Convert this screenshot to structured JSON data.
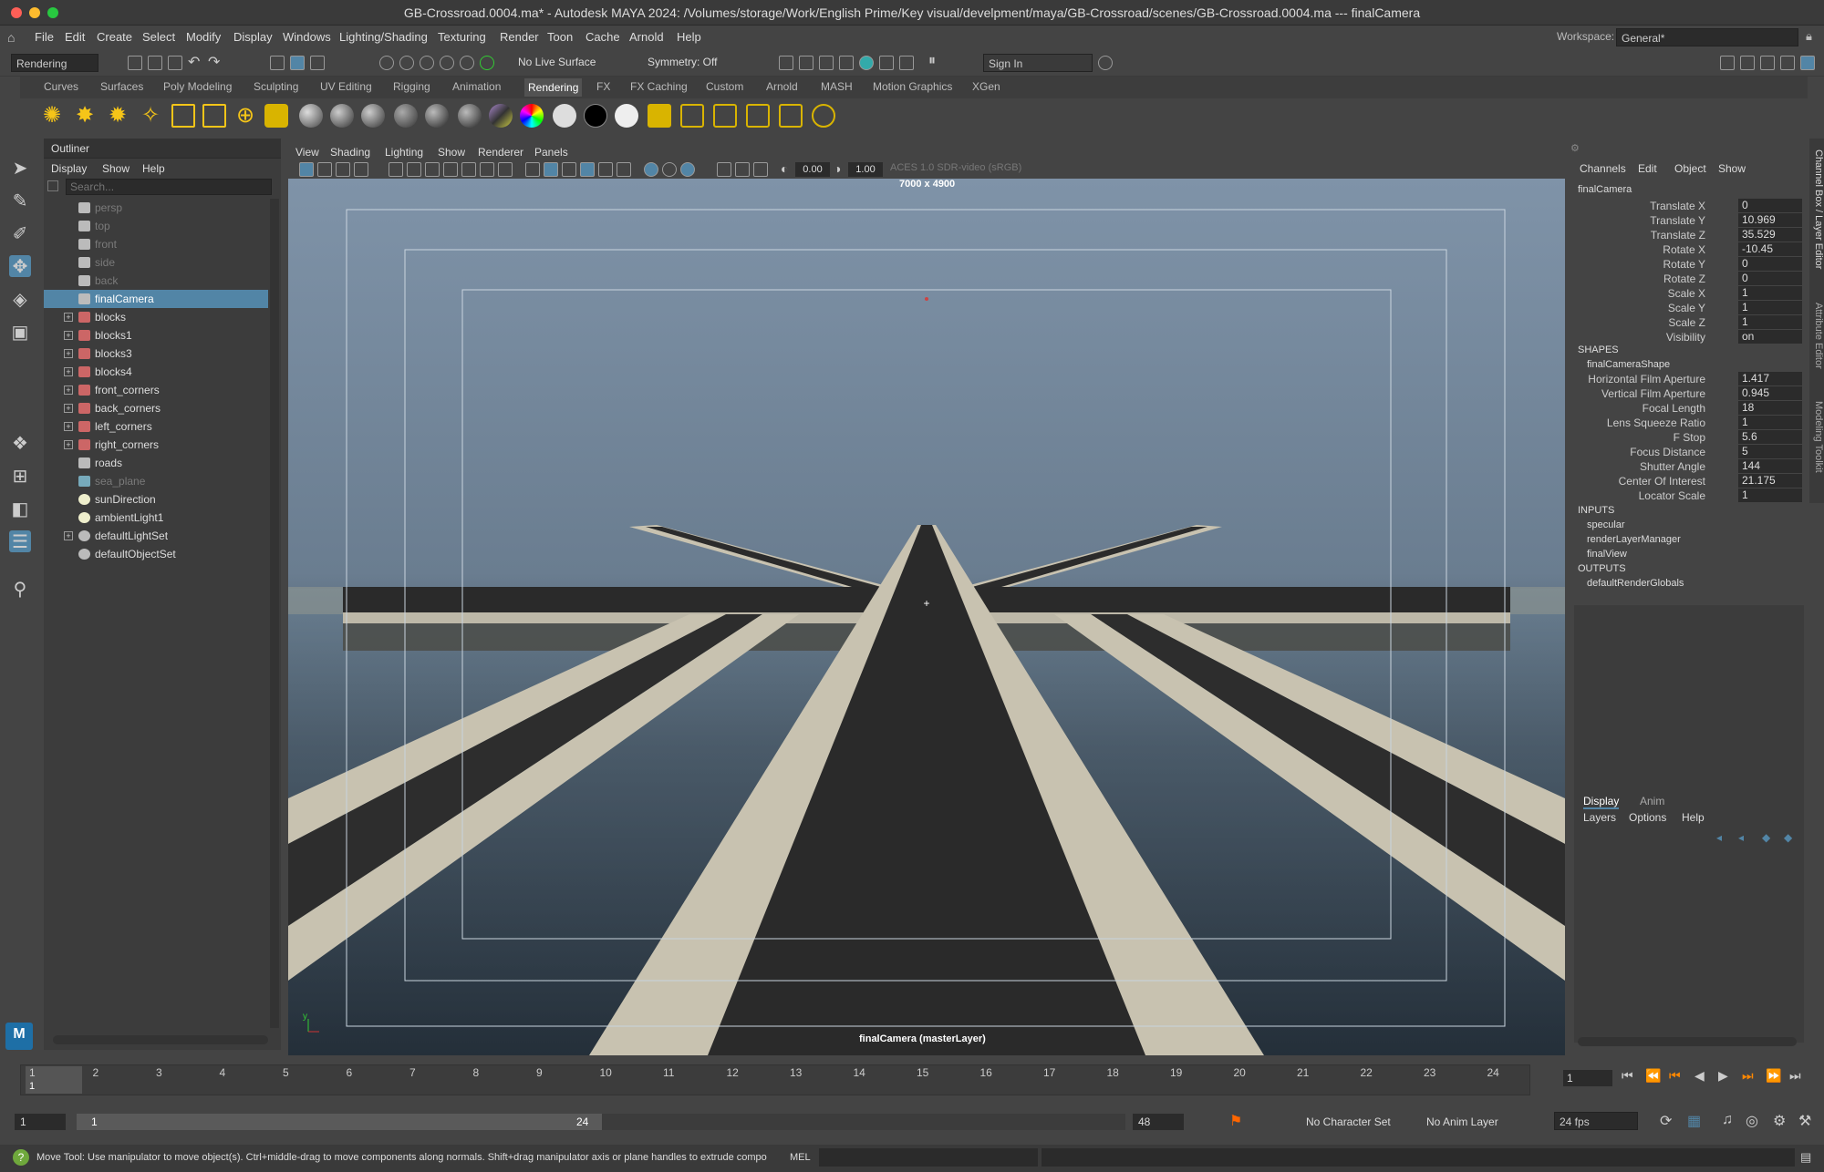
{
  "window": {
    "title": "GB-Crossroad.0004.ma* - Autodesk MAYA 2024: /Volumes/storage/Work/English Prime/Key visual/develpment/maya/GB-Crossroad/scenes/GB-Crossroad.0004.ma  ---  finalCamera"
  },
  "menubar": {
    "items": [
      "File",
      "Edit",
      "Create",
      "Select",
      "Modify",
      "Display",
      "Windows",
      "Lighting/Shading",
      "Texturing",
      "Render",
      "Toon",
      "Cache",
      "Arnold",
      "Help"
    ],
    "workspace_label": "Workspace:",
    "workspace_value": "General*"
  },
  "toolbar": {
    "mode_menu": "Rendering",
    "live_surface": "No Live Surface",
    "symmetry": "Symmetry: Off",
    "sign_in": "Sign In"
  },
  "shelf": {
    "tabs": [
      "Curves",
      "Surfaces",
      "Poly Modeling",
      "Sculpting",
      "UV Editing",
      "Rigging",
      "Animation",
      "Rendering",
      "FX",
      "FX Caching",
      "Custom",
      "Arnold",
      "MASH",
      "Motion Graphics",
      "XGen"
    ],
    "active_tab": "Rendering"
  },
  "outliner": {
    "title": "Outliner",
    "menus": [
      "Display",
      "Show",
      "Help"
    ],
    "search_placeholder": "Search...",
    "items": [
      {
        "name": "persp",
        "kind": "camera",
        "dim": true,
        "expand": false,
        "selected": false
      },
      {
        "name": "top",
        "kind": "camera",
        "dim": true,
        "expand": false,
        "selected": false
      },
      {
        "name": "front",
        "kind": "camera",
        "dim": true,
        "expand": false,
        "selected": false
      },
      {
        "name": "side",
        "kind": "camera",
        "dim": true,
        "expand": false,
        "selected": false
      },
      {
        "name": "back",
        "kind": "camera",
        "dim": true,
        "expand": false,
        "selected": false
      },
      {
        "name": "finalCamera",
        "kind": "camera",
        "dim": false,
        "expand": false,
        "selected": true
      },
      {
        "name": "blocks",
        "kind": "group",
        "dim": false,
        "expand": true,
        "selected": false
      },
      {
        "name": "blocks1",
        "kind": "group",
        "dim": false,
        "expand": true,
        "selected": false
      },
      {
        "name": "blocks3",
        "kind": "group",
        "dim": false,
        "expand": true,
        "selected": false
      },
      {
        "name": "blocks4",
        "kind": "group",
        "dim": false,
        "expand": true,
        "selected": false
      },
      {
        "name": "front_corners",
        "kind": "group",
        "dim": false,
        "expand": true,
        "selected": false
      },
      {
        "name": "back_corners",
        "kind": "group",
        "dim": false,
        "expand": true,
        "selected": false
      },
      {
        "name": "left_corners",
        "kind": "group",
        "dim": false,
        "expand": true,
        "selected": false
      },
      {
        "name": "right_corners",
        "kind": "group",
        "dim": false,
        "expand": true,
        "selected": false
      },
      {
        "name": "roads",
        "kind": "mesh",
        "dim": false,
        "expand": false,
        "selected": false
      },
      {
        "name": "sea_plane",
        "kind": "plane",
        "dim": true,
        "expand": false,
        "selected": false
      },
      {
        "name": "sunDirection",
        "kind": "light",
        "dim": false,
        "expand": false,
        "selected": false
      },
      {
        "name": "ambientLight1",
        "kind": "light",
        "dim": false,
        "expand": false,
        "selected": false
      },
      {
        "name": "defaultLightSet",
        "kind": "set",
        "dim": false,
        "expand": true,
        "selected": false
      },
      {
        "name": "defaultObjectSet",
        "kind": "set",
        "dim": false,
        "expand": false,
        "selected": false
      }
    ]
  },
  "viewport": {
    "menus": [
      "View",
      "Shading",
      "Lighting",
      "Show",
      "Renderer",
      "Panels"
    ],
    "exposure": "0.00",
    "gamma": "1.00",
    "color_space": "ACES 1.0 SDR-video (sRGB)",
    "resolution": "7000 x 4900",
    "camera_label": "finalCamera (masterLayer)"
  },
  "channel_box": {
    "menus": [
      "Channels",
      "Edit",
      "Object",
      "Show"
    ],
    "node": "finalCamera",
    "channels": [
      {
        "label": "Translate X",
        "value": "0"
      },
      {
        "label": "Translate Y",
        "value": "10.969"
      },
      {
        "label": "Translate Z",
        "value": "35.529"
      },
      {
        "label": "Rotate X",
        "value": "-10.45"
      },
      {
        "label": "Rotate Y",
        "value": "0"
      },
      {
        "label": "Rotate Z",
        "value": "0"
      },
      {
        "label": "Scale X",
        "value": "1"
      },
      {
        "label": "Scale Y",
        "value": "1"
      },
      {
        "label": "Scale Z",
        "value": "1"
      },
      {
        "label": "Visibility",
        "value": "on"
      }
    ],
    "shapes_header": "SHAPES",
    "shape_node": "finalCameraShape",
    "shape_channels": [
      {
        "label": "Horizontal Film Aperture",
        "value": "1.417"
      },
      {
        "label": "Vertical Film Aperture",
        "value": "0.945"
      },
      {
        "label": "Focal Length",
        "value": "18"
      },
      {
        "label": "Lens Squeeze Ratio",
        "value": "1"
      },
      {
        "label": "F Stop",
        "value": "5.6"
      },
      {
        "label": "Focus Distance",
        "value": "5"
      },
      {
        "label": "Shutter Angle",
        "value": "144"
      },
      {
        "label": "Center Of Interest",
        "value": "21.175"
      },
      {
        "label": "Locator Scale",
        "value": "1"
      }
    ],
    "inputs_header": "INPUTS",
    "inputs": [
      "specular",
      "renderLayerManager",
      "finalView"
    ],
    "outputs_header": "OUTPUTS",
    "outputs": [
      "defaultRenderGlobals"
    ]
  },
  "layer_editor": {
    "tabs": [
      "Display",
      "Anim"
    ],
    "menus": [
      "Layers",
      "Options",
      "Help"
    ]
  },
  "side_tabs": [
    "Channel Box / Layer Editor",
    "Attribute Editor",
    "Modeling Toolkit"
  ],
  "timeline": {
    "ticks": [
      "1",
      "2",
      "3",
      "4",
      "5",
      "6",
      "7",
      "8",
      "9",
      "10",
      "11",
      "12",
      "13",
      "14",
      "15",
      "16",
      "17",
      "18",
      "19",
      "20",
      "21",
      "22",
      "23",
      "24"
    ],
    "current_frame_marker": "1",
    "current_frame_field": "1"
  },
  "range": {
    "start": "1",
    "range_start": "1",
    "range_end": "24",
    "end": "48",
    "character_set": "No Character Set",
    "anim_layer": "No Anim Layer",
    "fps": "24 fps"
  },
  "help_line": {
    "message": "Move Tool: Use manipulator to move object(s). Ctrl+middle-drag to move components along normals. Shift+drag manipulator axis or plane handles to extrude compo",
    "mel_label": "MEL"
  },
  "colors": {
    "accent": "#5285a6",
    "selection": "#5285a6",
    "bg": "#444444"
  }
}
